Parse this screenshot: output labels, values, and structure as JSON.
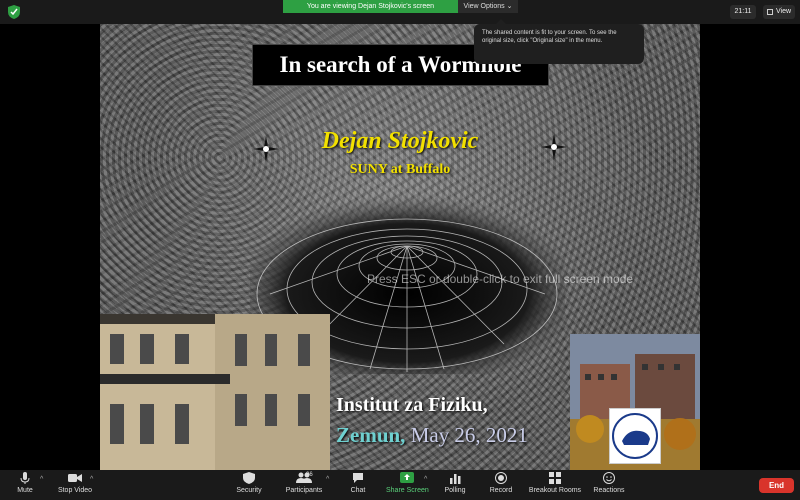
{
  "topbar": {
    "banner": "You are viewing Dejan Stojkovic's screen",
    "view_options": "View Options ⌄",
    "time": "21:11",
    "view_label": "View"
  },
  "tooltip": {
    "text": "The shared content is fit to your screen. To see the original size, click \"Original size\" in the menu."
  },
  "slide": {
    "title": "In search of a Wormhole",
    "speaker": "Dejan Stojkovic",
    "affiliation": "SUNY at Buffalo",
    "institute": "Institut za Fiziku,",
    "place": "Zemun,",
    "date": "May 26, 2021"
  },
  "esc_hint": "Press ESC or double-click to exit full screen mode",
  "toolbar": {
    "mute": "Mute",
    "stop_video": "Stop Video",
    "security": "Security",
    "participants": "Participants",
    "participants_count": "26",
    "chat": "Chat",
    "share_screen": "Share Screen",
    "polling": "Polling",
    "record": "Record",
    "breakout_rooms": "Breakout Rooms",
    "reactions": "Reactions",
    "end": "End"
  },
  "colors": {
    "share_green": "#2ea043",
    "end_red": "#d9342b",
    "speaker_yellow": "#f2e000",
    "place_cyan": "#6fd0d0"
  }
}
